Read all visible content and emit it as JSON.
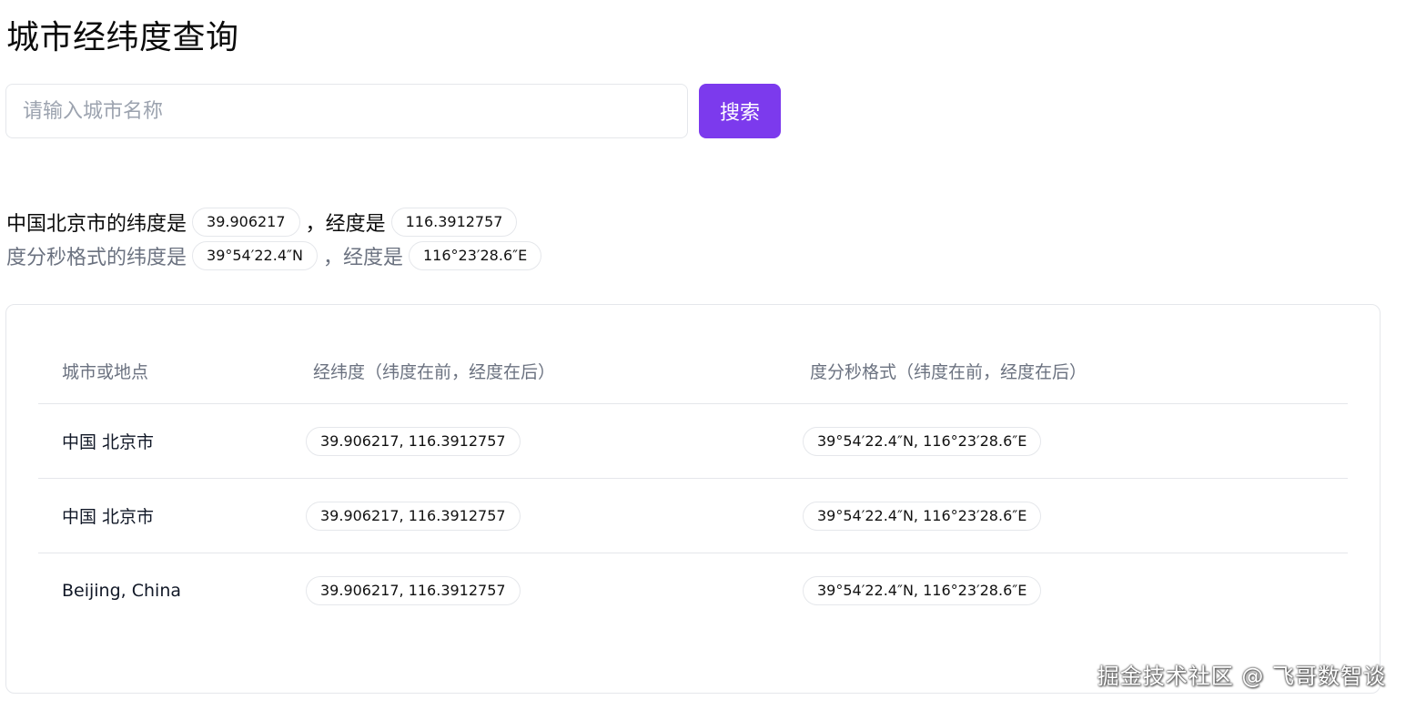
{
  "page": {
    "title": "城市经纬度查询"
  },
  "search": {
    "placeholder": "请输入城市名称",
    "value": "",
    "button_label": "搜索"
  },
  "result": {
    "line1_prefix": "中国北京市的纬度是",
    "latitude": "39.906217",
    "separator": "，",
    "longitude_label": "经度是",
    "longitude": "116.3912757",
    "line2_prefix": "度分秒格式的纬度是",
    "latitude_dms": "39°54′22.4″N",
    "longitude_dms": "116°23′28.6″E"
  },
  "table": {
    "headers": [
      "城市或地点",
      "经纬度（纬度在前，经度在后）",
      "度分秒格式（纬度在前，经度在后）"
    ],
    "rows": [
      {
        "place": "中国 北京市",
        "coords": "39.906217, 116.3912757",
        "dms": "39°54′22.4″N, 116°23′28.6″E"
      },
      {
        "place": "中国 北京市",
        "coords": "39.906217, 116.3912757",
        "dms": "39°54′22.4″N, 116°23′28.6″E"
      },
      {
        "place": "Beijing, China",
        "coords": "39.906217, 116.3912757",
        "dms": "39°54′22.4″N, 116°23′28.6″E"
      }
    ]
  },
  "watermark": "掘金技术社区 @ 飞哥数智谈",
  "colors": {
    "accent": "#7c3aed",
    "border": "#e5e7eb",
    "muted_text": "#6b7280"
  }
}
